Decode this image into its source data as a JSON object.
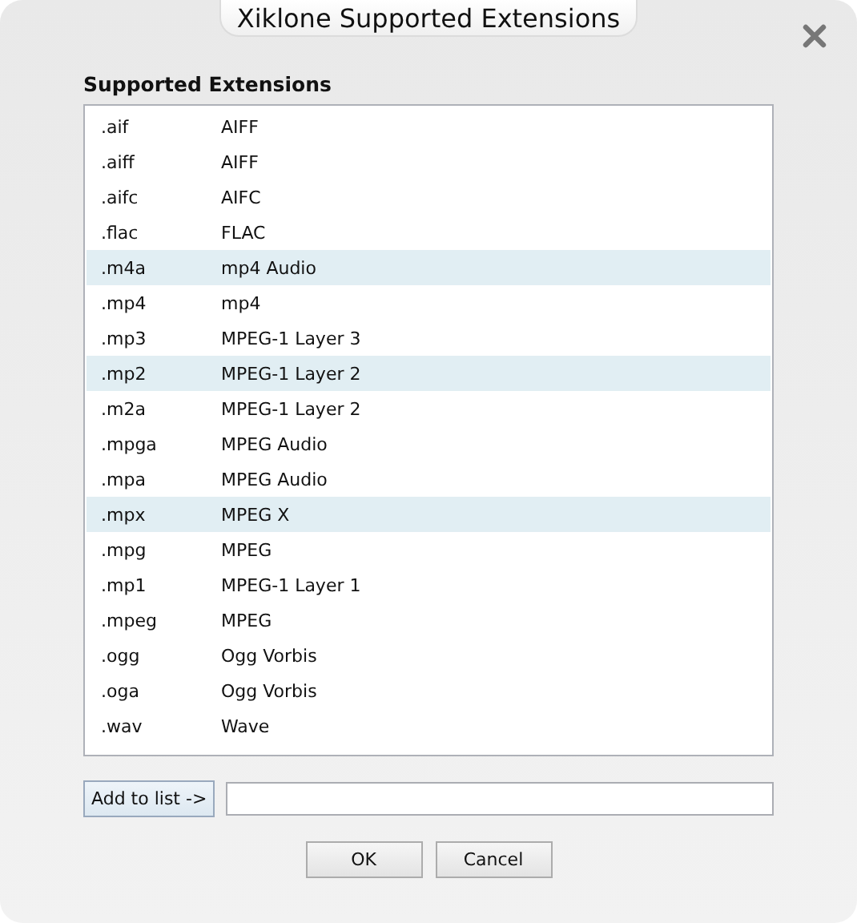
{
  "window": {
    "title": "Xiklone Supported Extensions"
  },
  "list": {
    "label": "Supported Extensions",
    "rows": [
      {
        "extension": ".aif",
        "format": "AIFF",
        "highlighted": false
      },
      {
        "extension": ".aiff",
        "format": "AIFF",
        "highlighted": false
      },
      {
        "extension": ".aifc",
        "format": "AIFC",
        "highlighted": false
      },
      {
        "extension": ".flac",
        "format": "FLAC",
        "highlighted": false
      },
      {
        "extension": ".m4a",
        "format": "mp4 Audio",
        "highlighted": true
      },
      {
        "extension": ".mp4",
        "format": "mp4",
        "highlighted": false
      },
      {
        "extension": ".mp3",
        "format": "MPEG-1 Layer 3",
        "highlighted": false
      },
      {
        "extension": ".mp2",
        "format": "MPEG-1 Layer 2",
        "highlighted": true
      },
      {
        "extension": ".m2a",
        "format": "MPEG-1 Layer 2",
        "highlighted": false
      },
      {
        "extension": ".mpga",
        "format": "MPEG Audio",
        "highlighted": false
      },
      {
        "extension": ".mpa",
        "format": "MPEG Audio",
        "highlighted": false
      },
      {
        "extension": ".mpx",
        "format": "MPEG X",
        "highlighted": true
      },
      {
        "extension": ".mpg",
        "format": "MPEG",
        "highlighted": false
      },
      {
        "extension": ".mp1",
        "format": "MPEG-1 Layer 1",
        "highlighted": false
      },
      {
        "extension": ".mpeg",
        "format": "MPEG",
        "highlighted": false
      },
      {
        "extension": ".ogg",
        "format": "Ogg Vorbis",
        "highlighted": false
      },
      {
        "extension": ".oga",
        "format": "Ogg Vorbis",
        "highlighted": false
      },
      {
        "extension": ".wav",
        "format": "Wave",
        "highlighted": false
      }
    ]
  },
  "add_button": "Add to list ->",
  "buttons": [
    "OK",
    "Cancel"
  ]
}
